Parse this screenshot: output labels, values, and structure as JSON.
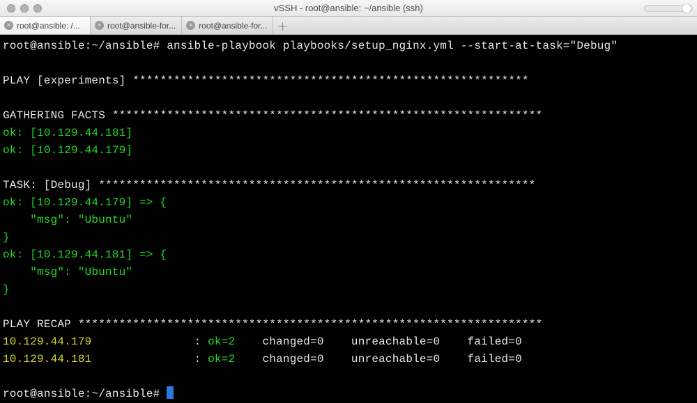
{
  "window": {
    "title": "vSSH - root@ansible: ~/ansible (ssh)"
  },
  "tabs": [
    {
      "label": "root@ansible: /...",
      "active": true
    },
    {
      "label": "root@ansible-for...",
      "active": false
    },
    {
      "label": "root@ansible-for...",
      "active": false
    }
  ],
  "terminal": {
    "prompt1": "root@ansible:~/ansible# ",
    "command": "ansible-playbook playbooks/setup_nginx.yml --start-at-task=\"Debug\"",
    "play_header_label": "PLAY [experiments] ",
    "play_header_stars": "**********************************************************",
    "gather_label": "GATHERING FACTS ",
    "gather_stars": "***************************************************************",
    "gather_lines": [
      "ok: [10.129.44.181]",
      "ok: [10.129.44.179]"
    ],
    "task_label": "TASK: [Debug] ",
    "task_stars": "****************************************************************",
    "task_out": {
      "h1_open": "ok: [10.129.44.179] => {",
      "h1_msg": "    \"msg\": \"Ubuntu\"",
      "h2_open": "ok: [10.129.44.181] => {",
      "h2_msg": "    \"msg\": \"Ubuntu\"",
      "close": "}"
    },
    "recap_label": "PLAY RECAP ",
    "recap_stars": "********************************************************************",
    "recap_rows": [
      {
        "host": "10.129.44.179",
        "host_pad": "              ",
        "sep": " : ",
        "ok": "ok=2   ",
        "rest": " changed=0    unreachable=0    failed=0"
      },
      {
        "host": "10.129.44.181",
        "host_pad": "              ",
        "sep": " : ",
        "ok": "ok=2   ",
        "rest": " changed=0    unreachable=0    failed=0"
      }
    ],
    "prompt2": "root@ansible:~/ansible# "
  }
}
